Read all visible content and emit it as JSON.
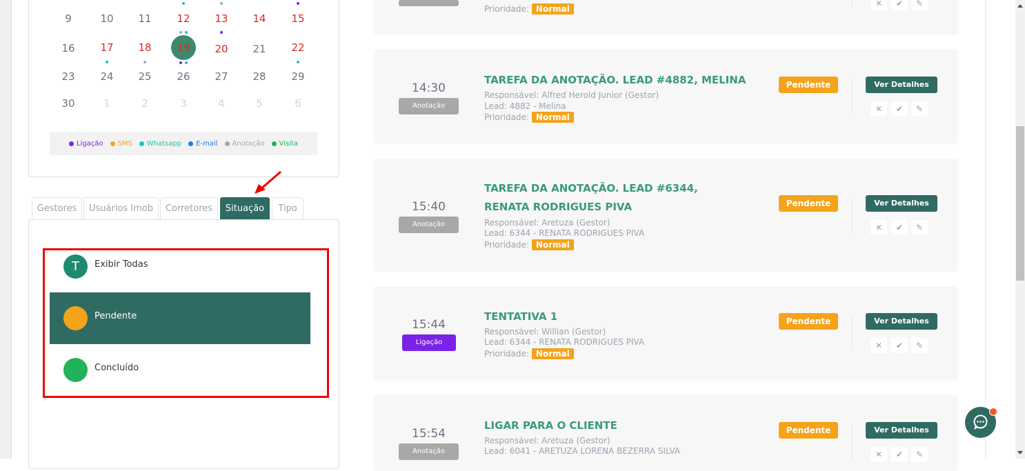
{
  "calendar": {
    "rows": [
      {
        "days": [
          "9",
          "10",
          "11",
          "12",
          "13",
          "14",
          "15"
        ]
      },
      {
        "days": [
          "16",
          "17",
          "18",
          "19",
          "20",
          "21",
          "22"
        ]
      },
      {
        "days": [
          "23",
          "24",
          "25",
          "26",
          "27",
          "28",
          "29"
        ]
      },
      {
        "days": [
          "30",
          "1",
          "2",
          "3",
          "4",
          "5",
          "6"
        ]
      }
    ],
    "today": "19"
  },
  "legend": [
    {
      "label": "Ligação",
      "color": "#7a22e8"
    },
    {
      "label": "SMS",
      "color": "#f5a31a"
    },
    {
      "label": "Whatsapp",
      "color": "#1ec4b4"
    },
    {
      "label": "E-mail",
      "color": "#1e7ae8"
    },
    {
      "label": "Anotação",
      "color": "#a8a8a8"
    },
    {
      "label": "Visita",
      "color": "#22b25a"
    }
  ],
  "tabs": [
    "Gestores",
    "Usuários Imob",
    "Corretores",
    "Situação",
    "Tipo"
  ],
  "active_tab": "Situação",
  "filters": [
    {
      "letter": "T",
      "label": "Exibir Todas",
      "color": "#1f8a6e"
    },
    {
      "letter": "",
      "label": "Pendente",
      "color": "#f5a31a"
    },
    {
      "letter": "",
      "label": "Concluído",
      "color": "#22b25a"
    }
  ],
  "tasks": [
    {
      "prioridade_label": "Prioridade:",
      "prioridade": "Normal"
    },
    {
      "time": "14:30",
      "type": "Anotação",
      "title": "TAREFA DA ANOTAÇÃO. LEAD #4882, MELINA",
      "responsavel": "Responsável: Alfred Herold Junior (Gestor)",
      "lead": "Lead: 4882 - Melina",
      "prioridade_label": "Prioridade:",
      "prioridade": "Normal",
      "status": "Pendente",
      "details": "Ver Detalhes"
    },
    {
      "time": "15:40",
      "type": "Anotação",
      "title": "TAREFA DA ANOTAÇÃO. LEAD #6344, RENATA RODRIGUES PIVA",
      "responsavel": "Responsável: Aretuza (Gestor)",
      "lead": "Lead: 6344 - RENATA RODRIGUES PIVA",
      "prioridade_label": "Prioridade:",
      "prioridade": "Normal",
      "status": "Pendente",
      "details": "Ver Detalhes"
    },
    {
      "time": "15:44",
      "type": "Ligação",
      "title": "TENTATIVA 1",
      "responsavel": "Responsável: Willian (Gestor)",
      "lead": "Lead: 6344 - RENATA RODRIGUES PIVA",
      "prioridade_label": "Prioridade:",
      "prioridade": "Normal",
      "status": "Pendente",
      "details": "Ver Detalhes"
    },
    {
      "time": "15:54",
      "type": "Anotação",
      "title": "LIGAR PARA O CLIENTE",
      "responsavel": "Responsável: Aretuza (Gestor)",
      "lead": "Lead: 6041 - ARETUZA LORENA BEZERRA SILVA",
      "status": "Pendente",
      "details": "Ver Detalhes"
    }
  ]
}
